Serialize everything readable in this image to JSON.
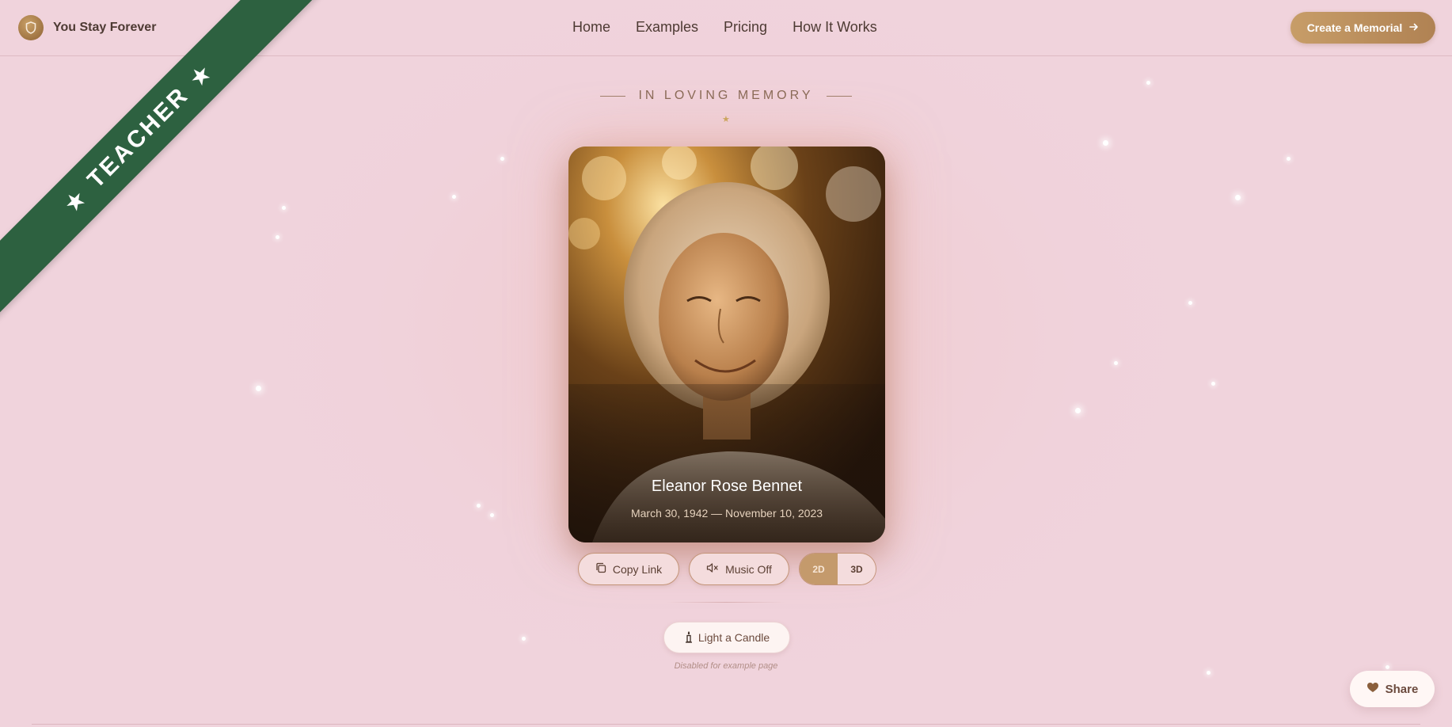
{
  "brand": {
    "name": "You Stay Forever",
    "logo_icon": "shield-icon"
  },
  "nav": {
    "items": [
      "Home",
      "Examples",
      "Pricing",
      "How It Works"
    ]
  },
  "header": {
    "cta_label": "Create a Memorial",
    "cta_icon": "arrow-right-icon"
  },
  "ribbon": {
    "label": "TEACHER",
    "star_icon": "star-icon",
    "color": "#2d6140"
  },
  "heading": {
    "text": "IN LOVING MEMORY",
    "star": "★"
  },
  "memorial": {
    "name": "Eleanor Rose Bennet",
    "dates": "March 30, 1942 — November 10, 2023"
  },
  "controls": {
    "copy_link": "Copy Link",
    "music": "Music Off",
    "view_options": [
      "2D",
      "3D"
    ],
    "view_selected": "2D"
  },
  "candle": {
    "label": "Light a Candle",
    "note": "Disabled for example page"
  },
  "share": {
    "label": "Share",
    "icon": "heart-icon"
  },
  "colors": {
    "background": "#f0d3dc",
    "accent": "#c49a6c",
    "ribbon": "#2d6140",
    "text": "#4d3a33"
  }
}
